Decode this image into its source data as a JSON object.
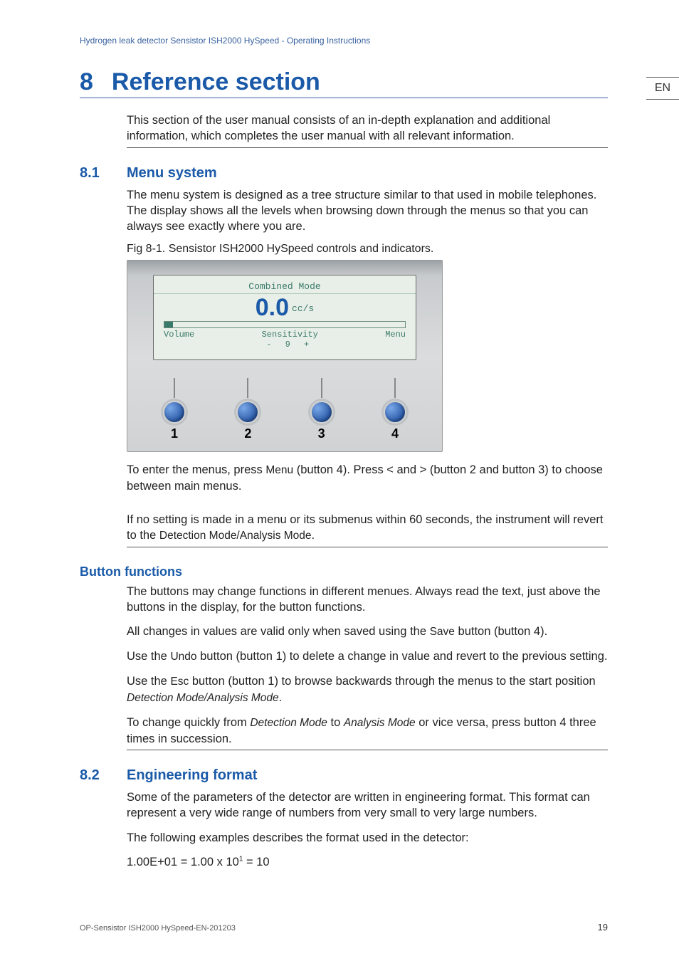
{
  "header": {
    "left": "Hydrogen leak detector Sensistor ISH2000 HySpeed",
    "sep": " - ",
    "right": "Operating Instructions"
  },
  "lang_tab": "EN",
  "chapter": {
    "num": "8",
    "title": "Reference section"
  },
  "intro": "This section of the user manual consists of an in-depth explanation and additional information, which completes the user manual with all relevant information.",
  "s81": {
    "num": "8.1",
    "title": "Menu system",
    "p1": "The menu system is designed as a tree structure similar to that used in mobile telephones. The display shows all the levels when browsing down through the menus so that you can always see exactly where you are.",
    "figcap": "Fig 8-1. Sensistor ISH2000 HySpeed controls and indicators.",
    "screen": {
      "mode": "Combined Mode",
      "value": "0.0",
      "unit": "cc/s",
      "left": "Volume",
      "sens": "Sensitivity",
      "sens_nums": "- 9 +",
      "right": "Menu",
      "knobs": [
        "1",
        "2",
        "3",
        "4"
      ]
    },
    "p2a": "To enter the menus, press ",
    "p2_menu": "Menu",
    "p2b": " (button 4). Press < and > (button 2 and button 3) to choose between main menus.",
    "p3a": "If no setting is made in a menu or its submenus within 60 seconds, the instrument will revert to the ",
    "p3_mode": "Detection Mode/Analysis Mode",
    "p3b": "."
  },
  "btnfn": {
    "title": "Button functions",
    "p1": "The buttons may change functions in different menues. Always read the text, just above the buttons in the display, for the button functions.",
    "p2a": "All changes in values are valid only when saved using the ",
    "p2_save": "Save",
    "p2b": " button (button 4).",
    "p3a": "Use the ",
    "p3_undo": "Undo",
    "p3b": " button (button 1) to delete a change in value and revert to the previous setting.",
    "p4a": "Use the ",
    "p4_esc": "Esc",
    "p4b": " button (button 1) to browse backwards through the menus to the start position ",
    "p4_mode": "Detection Mode/Analysis Mode",
    "p4c": ".",
    "p5a": "To change quickly from ",
    "p5_d": "Detection Mode",
    "p5b": " to ",
    "p5_a": "Analysis Mode",
    "p5c": " or vice versa, press button 4 three times in succession."
  },
  "s82": {
    "num": "8.2",
    "title": "Engineering format",
    "p1": "Some of the parameters of the detector are written in engineering format. This format can represent a very wide range of numbers from very small to very large numbers.",
    "p2": "The following examples describes the format used in the detector:",
    "eq_a": "1.00E+01 = 1.00 x 10",
    "eq_sup": "1",
    "eq_b": " = 10"
  },
  "footer": "OP-Sensistor ISH2000 HySpeed-EN-201203",
  "page_num": "19"
}
